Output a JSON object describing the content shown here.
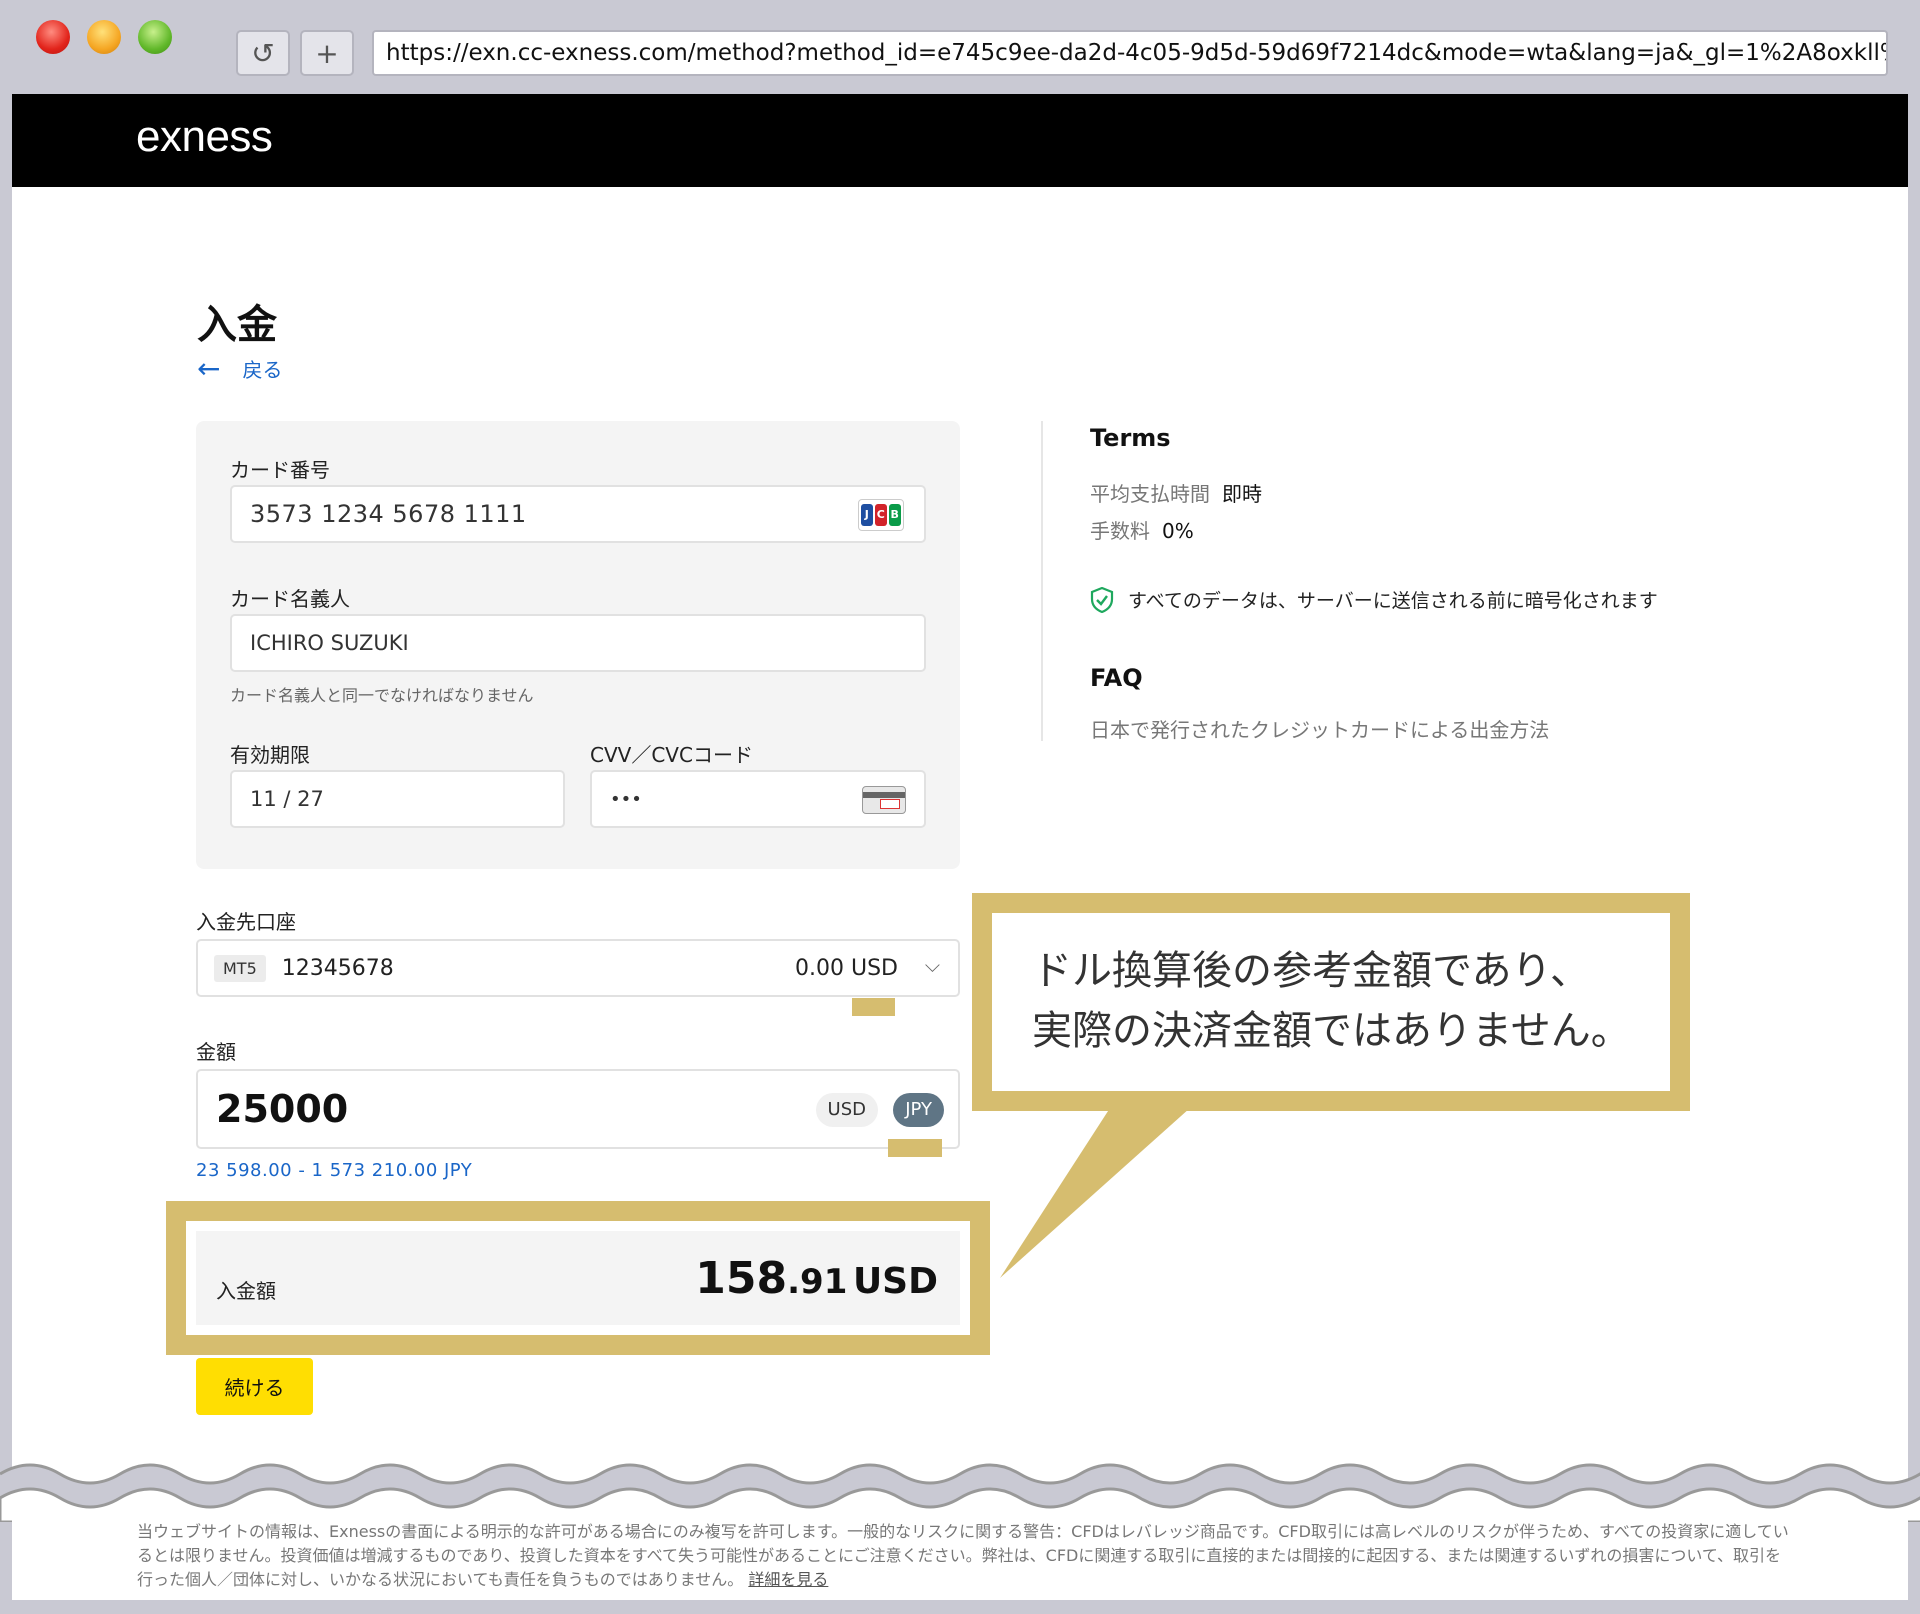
{
  "browser": {
    "url": "https://exn.cc-exness.com/method?method_id=e745c9ee-da2d-4c05-9d5d-59d69f7214dc&mode=wta&lang=ja&_gl=1%2A8oxkll%2A_ga%"
  },
  "header": {
    "logo": "exness"
  },
  "page": {
    "title": "入金",
    "back_label": "戻る"
  },
  "card_form": {
    "card_number_label": "カード番号",
    "card_number_value": "3573 1234 5678 1111",
    "card_brand": "JCB",
    "holder_label": "カード名義人",
    "holder_value": "ICHIRO SUZUKI",
    "holder_hint": "カード名義人と同一でなければなりません",
    "expiry_label": "有効期限",
    "expiry_value": "11 / 27",
    "cvv_label": "CVV／CVCコード",
    "cvv_value": "•••"
  },
  "account": {
    "label": "入金先口座",
    "platform": "MT5",
    "number": "12345678",
    "balance": "0.00 USD"
  },
  "amount": {
    "label": "金額",
    "value": "25000",
    "currency_usd": "USD",
    "currency_jpy": "JPY",
    "selected_currency": "JPY",
    "range": "23 598.00 - 1 573 210.00 JPY"
  },
  "total": {
    "label": "入金額",
    "value_integer": "158",
    "value_decimal": ".91",
    "currency": "USD"
  },
  "continue_label": "続ける",
  "terms": {
    "heading": "Terms",
    "avg_time_label": "平均支払時間",
    "avg_time_value": "即時",
    "fee_label": "手数料",
    "fee_value": "0%",
    "secure_note": "すべてのデータは、サーバーに送信される前に暗号化されます"
  },
  "faq": {
    "heading": "FAQ",
    "link": "日本で発行されたクレジットカードによる出金方法"
  },
  "callout": {
    "line1": "ドル換算後の参考金額であり、",
    "line2": "実際の決済金額ではありません。"
  },
  "footer": {
    "text": "当ウェブサイトの情報は、Exnessの書面による明示的な許可がある場合にのみ複写を許可します。一般的なリスクに関する警告：CFDはレバレッジ商品です。CFD取引には高レベルのリスクが伴うため、すべての投資家に適しているとは限りません。投資価値は増減するものであり、投資した資本をすべて失う可能性があることにご注意ください。弊社は、CFDに関連する取引に直接的または間接的に起因する、または関連するいずれの損害について、取引を行った個人／団体に対し、いかなる状況においても責任を負うものではありません。",
    "link": "詳細を見る"
  },
  "colors": {
    "accent_yellow": "#ffde02",
    "highlight_gold": "#d6bd6f",
    "link_blue": "#1a66c8",
    "jpy_pill": "#5f7585"
  }
}
